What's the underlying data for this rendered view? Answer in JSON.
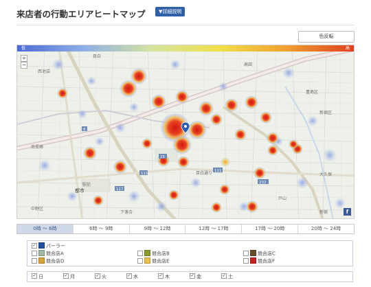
{
  "header": {
    "title": "来店者の行動エリアヒートマップ",
    "detail_button": "▼詳細説明"
  },
  "color_button": "色反転",
  "map": {
    "scale_min": "低",
    "scale_max": "高",
    "zoom_in": "+",
    "zoom_out": "−",
    "fb": "f",
    "place_labels": [
      "西池袋",
      "南長崎",
      "豊島区",
      "目白",
      "高田",
      "駅前",
      "下落合",
      "新宿",
      "戸山",
      "大久保",
      "目白通り",
      "中野区",
      "新宿区"
    ],
    "route_labels": [
      "111",
      "8",
      "25",
      "232",
      "117",
      "111"
    ],
    "station_label": "都市",
    "colors": {
      "hot": "#e02a1c",
      "warm": "#f2a33a",
      "cool": "#5b79d6",
      "pin": "#2d5fb0"
    }
  },
  "time_tabs": [
    {
      "label": "0時 〜 6時",
      "active": true
    },
    {
      "label": "6時 〜 9時",
      "active": false
    },
    {
      "label": "9時 〜 12時",
      "active": false
    },
    {
      "label": "12時 〜 17時",
      "active": false
    },
    {
      "label": "17時 〜 20時",
      "active": false
    },
    {
      "label": "20時 〜 24時",
      "active": false
    }
  ],
  "legend": [
    {
      "label": "パーラー",
      "checked": true,
      "color": "#1f4fa0"
    },
    {
      "label": "競合店A",
      "checked": false,
      "color": "#9fb8a4"
    },
    {
      "label": "競合店B",
      "checked": false,
      "color": "#8a9a2a"
    },
    {
      "label": "競合店C",
      "checked": false,
      "color": "#6b4a2a"
    },
    {
      "label": "競合店D",
      "checked": false,
      "color": "#d8a23a"
    },
    {
      "label": "競合店E",
      "checked": false,
      "color": "#e8c04a"
    },
    {
      "label": "競合店F",
      "checked": false,
      "color": "#c82020"
    }
  ],
  "days": [
    {
      "label": "日",
      "checked": true
    },
    {
      "label": "月",
      "checked": true
    },
    {
      "label": "火",
      "checked": true
    },
    {
      "label": "水",
      "checked": true
    },
    {
      "label": "木",
      "checked": true
    },
    {
      "label": "金",
      "checked": true
    },
    {
      "label": "土",
      "checked": true
    }
  ]
}
